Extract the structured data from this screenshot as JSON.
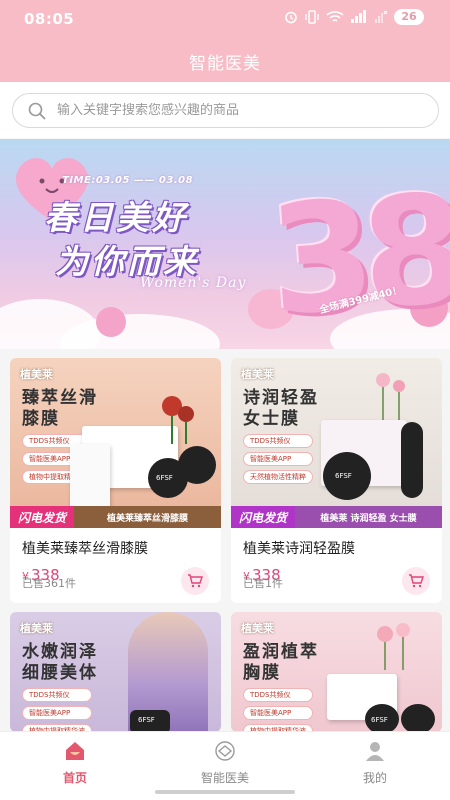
{
  "status_bar": {
    "time": "08:05",
    "battery": "26"
  },
  "header": {
    "title": "智能医美"
  },
  "search": {
    "placeholder": "输入关键字搜索您感兴趣的商品"
  },
  "banner": {
    "date": "TIME:03.05 —— 03.08",
    "title_line1": "春日美好",
    "title_line2": "为你而来",
    "subtitle": "Women's Day",
    "big_number": "38",
    "promo": "全场满399减40！"
  },
  "products": [
    {
      "brand": "植美莱",
      "heading_line1": "臻萃丝滑",
      "heading_line2": "膝膜",
      "tags": [
        "TDDS共频仪",
        "智能医美APP",
        "植物中提取精华液"
      ],
      "strip_badge": "闪电发货",
      "strip_text": "植美莱臻萃丝滑膝膜",
      "device_label": "6FSF",
      "name": "植美莱臻萃丝滑膝膜",
      "currency": "¥",
      "price": "338",
      "sold": "已售361件"
    },
    {
      "brand": "植美莱",
      "heading_line1": "诗润轻盈",
      "heading_line2": "女士膜",
      "tags": [
        "TDDS共频仪",
        "智能医美APP",
        "天然植物活性精粹"
      ],
      "strip_badge": "闪电发货",
      "strip_text": "植美莱 诗润轻盈 女士膜",
      "device_label": "6FSF",
      "name": "植美莱诗润轻盈膜",
      "currency": "¥",
      "price": "338",
      "sold": "已售1件"
    },
    {
      "brand": "植美莱",
      "heading_line1": "水嫩润泽",
      "heading_line2": "细腰美体",
      "tags": [
        "TDDS共频仪",
        "智能医美APP",
        "植物中提取精华液"
      ],
      "device_label": "6FSF"
    },
    {
      "brand": "植美莱",
      "heading_line1": "盈润植萃",
      "heading_line2": "胸膜",
      "tags": [
        "TDDS共频仪",
        "智能医美APP",
        "植物中提取精华液"
      ],
      "device_label": "6FSF"
    }
  ],
  "bottom_nav": [
    {
      "label": "首页",
      "icon": "home-icon",
      "active": true
    },
    {
      "label": "智能医美",
      "icon": "beauty-icon",
      "active": false
    },
    {
      "label": "我的",
      "icon": "profile-icon",
      "active": false
    }
  ],
  "colors": {
    "header_bg": "#f8bcc6",
    "accent": "#e4586e",
    "price": "#e0457b"
  }
}
